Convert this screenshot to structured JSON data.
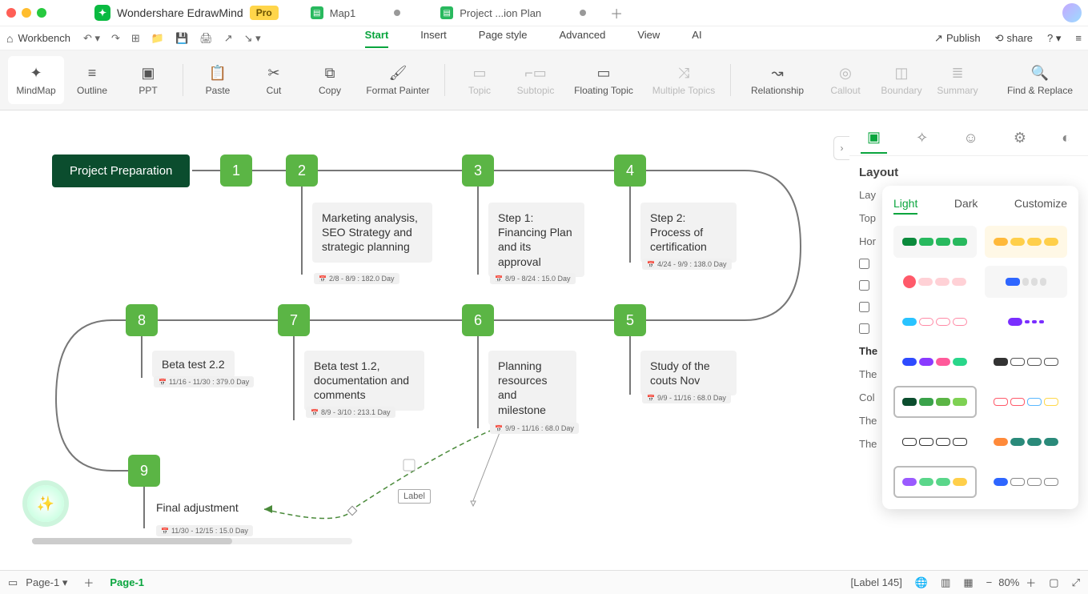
{
  "app": {
    "name": "Wondershare EdrawMind",
    "badge": "Pro"
  },
  "tabs": [
    {
      "label": "Map1",
      "active": false,
      "dirty": true
    },
    {
      "label": "Project ...ion Plan",
      "active": true,
      "dirty": true
    }
  ],
  "menubar": {
    "workbench": "Workbench",
    "items": [
      "Start",
      "Insert",
      "Page style",
      "Advanced",
      "View",
      "AI"
    ],
    "active": "Start",
    "publish": "Publish",
    "share": "share"
  },
  "toolbar": {
    "mindmap": "MindMap",
    "outline": "Outline",
    "ppt": "PPT",
    "paste": "Paste",
    "cut": "Cut",
    "copy": "Copy",
    "format_painter": "Format Painter",
    "topic": "Topic",
    "subtopic": "Subtopic",
    "floating_topic": "Floating Topic",
    "multiple_topics": "Multiple Topics",
    "relationship": "Relationship",
    "callout": "Callout",
    "boundary": "Boundary",
    "summary": "Summary",
    "find_replace": "Find & Replace"
  },
  "map": {
    "root": "Project Preparation",
    "nodes": [
      {
        "n": "1"
      },
      {
        "n": "2",
        "text": "Marketing analysis, SEO Strategy and strategic planning",
        "date": "2/8 - 8/9 : 182.0 Day"
      },
      {
        "n": "3",
        "text": "Step 1: Financing Plan and its approval",
        "date": "8/9 - 8/24 : 15.0 Day"
      },
      {
        "n": "4",
        "text": "Step 2: Process of certification",
        "date": "4/24 - 9/9 : 138.0 Day"
      },
      {
        "n": "5",
        "text": "Study of the couts Nov",
        "date": "9/9 - 11/16 : 68.0 Day"
      },
      {
        "n": "6",
        "text": "Planning resources and milestone",
        "date": "9/9 - 11/16 : 68.0 Day"
      },
      {
        "n": "7",
        "text": "Beta test 1.2, documentation and comments",
        "date": "8/9 - 3/10 : 213.1 Day"
      },
      {
        "n": "8",
        "text": "Beta test 2.2",
        "date": "11/16 - 11/30 : 379.0 Day"
      },
      {
        "n": "9",
        "text": "Final adjustment",
        "date": "11/30 - 12/15 : 15.0 Day"
      }
    ],
    "relationship_label": "Label"
  },
  "side": {
    "header": "Layout",
    "rows": [
      "Lay",
      "Top",
      "Hor",
      "The",
      "The",
      "Col",
      "The",
      "The"
    ]
  },
  "theme_popup": {
    "tabs": [
      "Light",
      "Dark",
      "Customize"
    ],
    "active": "Light"
  },
  "pagebar": {
    "selector": "Page-1",
    "active_page": "Page-1",
    "status": "[Label 145]",
    "zoom": "80%"
  }
}
